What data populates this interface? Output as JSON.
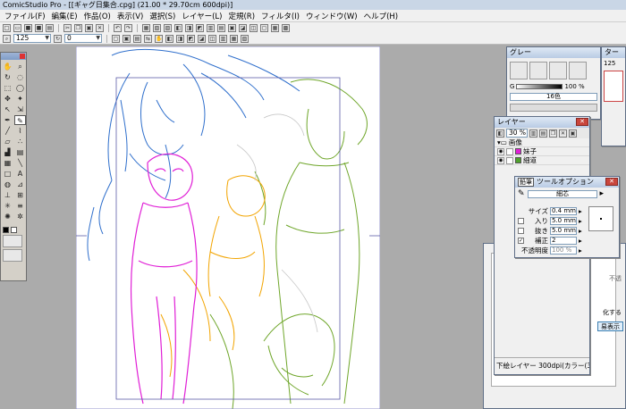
{
  "window": {
    "title": "ComicStudio Pro - [[ギャグ日集合.cpg] (21.00 * 29.70cm 600dpi)]"
  },
  "menu": [
    "ファイル(F)",
    "編集(E)",
    "作品(O)",
    "表示(V)",
    "選択(S)",
    "レイヤー(L)",
    "定規(R)",
    "フィルタ(I)",
    "ウィンドウ(W)",
    "ヘルプ(H)"
  ],
  "toolbar": {
    "zoom_value": "125",
    "angle_value": "0"
  },
  "gray_panel": {
    "title": "グレー",
    "value_label": "G",
    "percent": "100 %",
    "colors": "16色"
  },
  "navigator_panel": {
    "title": "ター",
    "value": "125"
  },
  "layer_panel": {
    "title": "レイヤー",
    "opacity": "30 %",
    "folder": "画像",
    "layers": [
      {
        "name": "妹子",
        "color": "#e01fd6"
      },
      {
        "name": "細道",
        "color": "#4fa12d"
      }
    ],
    "status": "下絵レイヤー 300dpi(カラー(3"
  },
  "tool_options": {
    "tag": "鉛筆",
    "title": "ツールオプション",
    "brush_name": "細芯",
    "rows": [
      {
        "label": "サイズ",
        "value": "0.4 mm"
      },
      {
        "label": "入り",
        "value": "5.0 mm"
      },
      {
        "label": "抜き",
        "value": "5.0 mm"
      },
      {
        "label": "補正",
        "value": "2"
      },
      {
        "label": "不透明度",
        "value": "100 %"
      }
    ]
  },
  "behind_panel": {
    "label1": "不透",
    "label2": "化する",
    "button": "易表示"
  },
  "colors": {
    "pink": "#e01fd6",
    "orange": "#f2a400",
    "green": "#6fa62a",
    "blue": "#2f6fcc"
  }
}
